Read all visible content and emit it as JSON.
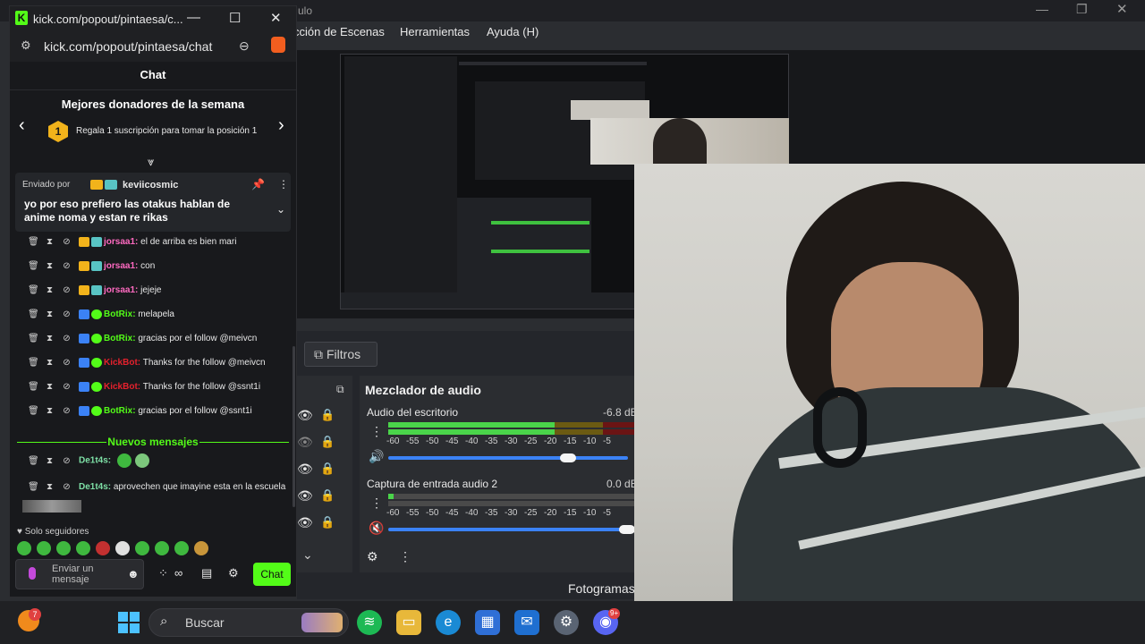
{
  "obs": {
    "menus": [
      "cción de Escenas",
      "Herramientas",
      "Ayuda (H)"
    ],
    "title_fragment": "ulo",
    "filters_tab": "Filtros",
    "fps_label": "Fotogramas",
    "mixer": {
      "title": "Mezclador de audio",
      "channels": [
        {
          "name": "Audio del escritorio",
          "db": "-6.8 dB",
          "level": 0.7
        },
        {
          "name": "Captura de entrada audio 2",
          "db": "0.0 dB",
          "level": 0.0
        }
      ],
      "scale": [
        "-60",
        "-55",
        "-50",
        "-45",
        "-40",
        "-35",
        "-30",
        "-25",
        "-20",
        "-15",
        "-10",
        "-5"
      ]
    }
  },
  "chat_window": {
    "title": "kick.com/popout/pintaesa/c...",
    "url": "kick.com/popout/pintaesa/chat",
    "header": "Chat",
    "donors_title": "Mejores donadores de la semana",
    "donors_badge": "1",
    "donors_sub": "Regala 1 suscripción para tomar la posición 1",
    "pinned": {
      "by_label": "Enviado por",
      "user": "keviicosmic",
      "message": "yo por eso prefiero las otakus hablan de anime noma y estan re rikas"
    },
    "messages": [
      {
        "user": "jorsaa1:",
        "text": "el de arriba es bien mari",
        "color": "#ff6ac1"
      },
      {
        "user": "jorsaa1:",
        "text": "con",
        "color": "#ff6ac1"
      },
      {
        "user": "jorsaa1:",
        "text": "jejeje",
        "color": "#ff6ac1"
      },
      {
        "user": "BotRix:",
        "text": "melapela",
        "color": "#53fc18"
      },
      {
        "user": "BotRix:",
        "text": "gracias por el follow @meivcn",
        "color": "#53fc18"
      },
      {
        "user": "KickBot:",
        "text": "Thanks for the follow @meivcn",
        "color": "#e5212d"
      },
      {
        "user": "KickBot:",
        "text": "Thanks for the follow @ssnt1i",
        "color": "#e5212d"
      },
      {
        "user": "BotRix:",
        "text": "gracias por el follow @ssnt1i",
        "color": "#53fc18"
      }
    ],
    "new_messages_label": "Nuevos mensajes",
    "new_messages": [
      {
        "user": "De1t4s:",
        "text": "",
        "color": "#7ee0a6"
      },
      {
        "user": "De1t4s:",
        "text": "aprovechen que imayine esta en la escuela",
        "color": "#7ee0a6"
      }
    ],
    "followers_only": "Solo seguidores",
    "input_placeholder": "Enviar un mensaje",
    "send_label": "Chat",
    "tools": [
      "∞"
    ]
  },
  "taskbar": {
    "search_label": "Buscar",
    "notif_count": "7",
    "discord_badge": "9+"
  },
  "colors": {
    "kick_green": "#53fc18",
    "taskbar": "#202124"
  }
}
